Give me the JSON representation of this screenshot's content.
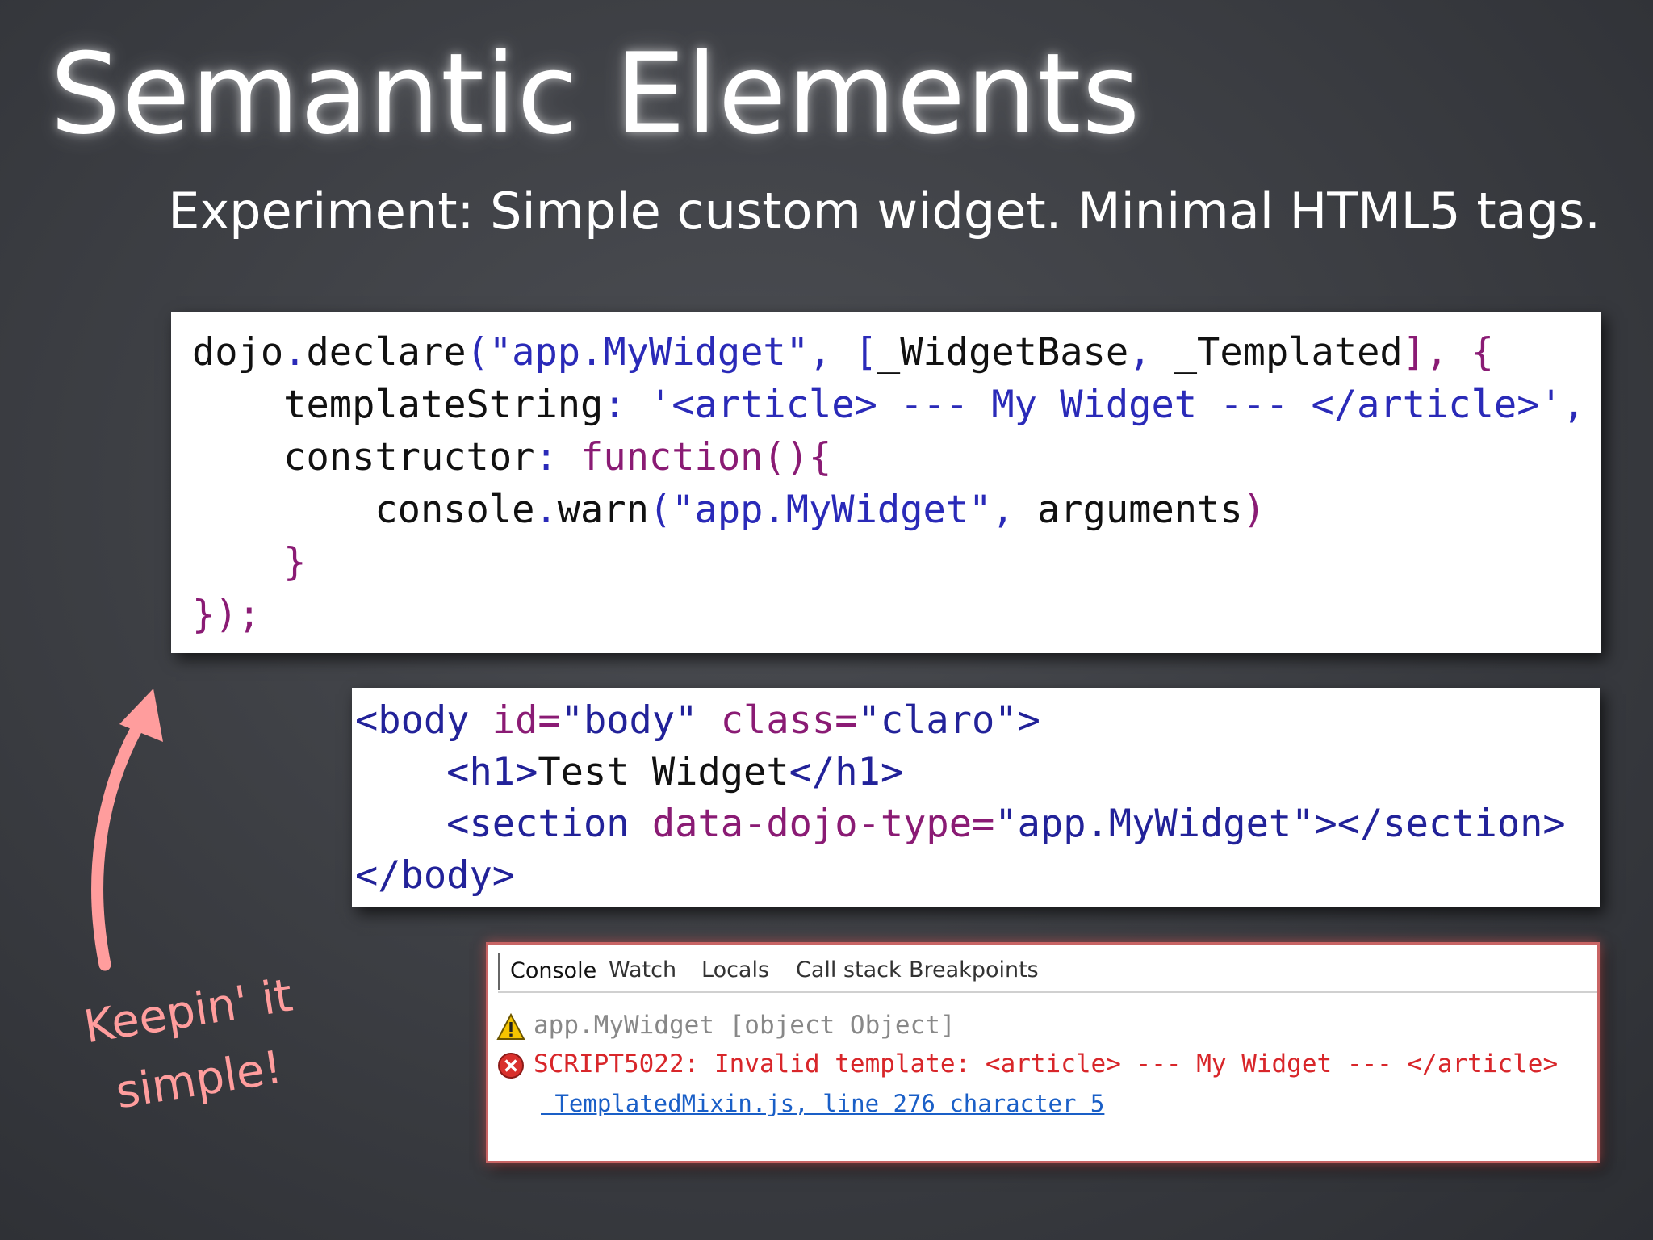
{
  "slide": {
    "title": "Semantic Elements",
    "subtitle": "Experiment: Simple custom widget. Minimal HTML5 tags.",
    "callout_line1": "Keepin' it",
    "callout_line2": "simple!"
  },
  "js_code": {
    "line1": [
      {
        "text": "dojo",
        "c": "black"
      },
      {
        "text": ".",
        "c": "blue"
      },
      {
        "text": "declare",
        "c": "black"
      },
      {
        "text": "(\"app",
        "c": "blue"
      },
      {
        "text": ".",
        "c": "blue"
      },
      {
        "text": "MyWidget\", [",
        "c": "blue"
      },
      {
        "text": "_WidgetBase",
        "c": "black"
      },
      {
        "text": ", ",
        "c": "blue"
      },
      {
        "text": "_Templated",
        "c": "black"
      },
      {
        "text": "], {",
        "c": "purple"
      }
    ],
    "line2": [
      {
        "text": "    templateString",
        "c": "black"
      },
      {
        "text": ": ",
        "c": "blue"
      },
      {
        "text": "'<article> --- My Widget --- </article>',",
        "c": "blue"
      }
    ],
    "line3": [
      {
        "text": "    constructor",
        "c": "black"
      },
      {
        "text": ": ",
        "c": "blue"
      },
      {
        "text": "function",
        "c": "purple"
      },
      {
        "text": "(){",
        "c": "purple"
      }
    ],
    "line4": [
      {
        "text": "        console",
        "c": "black"
      },
      {
        "text": ".",
        "c": "blue"
      },
      {
        "text": "warn",
        "c": "black"
      },
      {
        "text": "(\"app.MyWidget\", ",
        "c": "blue"
      },
      {
        "text": "arguments",
        "c": "black"
      },
      {
        "text": ")",
        "c": "purple"
      }
    ],
    "line5": [
      {
        "text": "    }",
        "c": "purple"
      }
    ],
    "line6": [
      {
        "text": "});",
        "c": "purple"
      }
    ]
  },
  "html_code": {
    "line1": [
      {
        "text": "<body",
        "c": "navy"
      },
      {
        "text": " id=",
        "c": "purple"
      },
      {
        "text": "\"body\"",
        "c": "navy"
      },
      {
        "text": " class=",
        "c": "purple"
      },
      {
        "text": "\"claro\"",
        "c": "navy"
      },
      {
        "text": ">",
        "c": "navy"
      }
    ],
    "line2": [
      {
        "text": "    <h1>",
        "c": "navy"
      },
      {
        "text": "Test Widget",
        "c": "black"
      },
      {
        "text": "</h1>",
        "c": "navy"
      }
    ],
    "line3": [
      {
        "text": "    <section",
        "c": "navy"
      },
      {
        "text": " data-dojo-type=",
        "c": "purple"
      },
      {
        "text": "\"app.MyWidget\"",
        "c": "navy"
      },
      {
        "text": "></section>",
        "c": "navy"
      }
    ],
    "line4": [
      {
        "text": "</body>",
        "c": "navy"
      }
    ]
  },
  "console": {
    "tabs": [
      "Console",
      "Watch",
      "Locals",
      "Call stack",
      "Breakpoints"
    ],
    "active_tab": "Console",
    "warning_text": "app.MyWidget [object Object]",
    "error_text": "SCRIPT5022: Invalid template: <article> --- My Widget --- </article>",
    "source_link": " TemplatedMixin.js, line 276 character 5",
    "warning_icon": "warning-triangle-icon",
    "error_icon": "error-circle-icon"
  },
  "colors": {
    "black": "#111111",
    "blue": "#2a2ab8",
    "purple": "#8a1b74",
    "navy": "#222299",
    "callout": "#ff9d9d",
    "error": "#d8262a"
  }
}
